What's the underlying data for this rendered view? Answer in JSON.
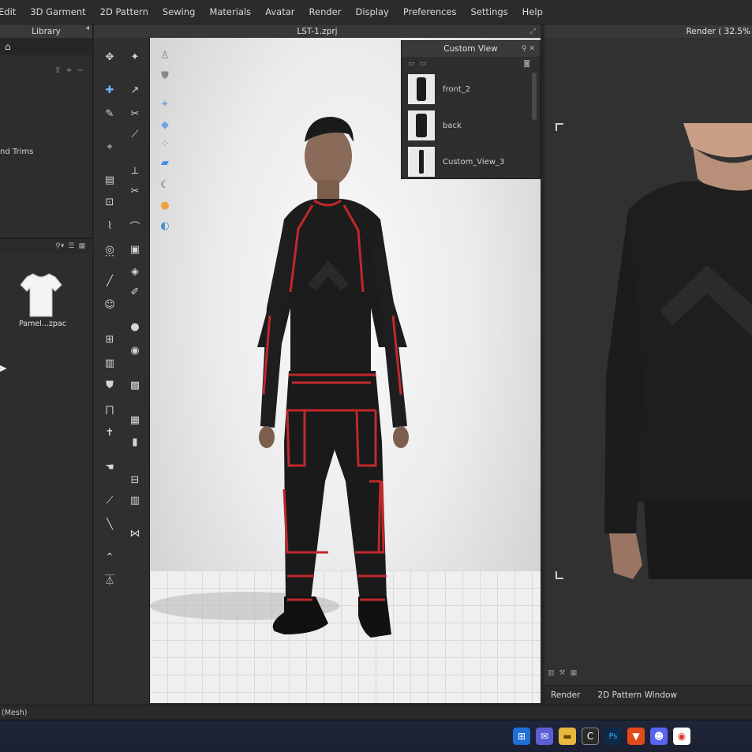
{
  "menu": {
    "items": [
      "Edit",
      "3D Garment",
      "2D Pattern",
      "Sewing",
      "Materials",
      "Avatar",
      "Render",
      "Display",
      "Preferences",
      "Settings",
      "Help"
    ]
  },
  "library": {
    "title": "Library",
    "item_label": "nd Trims",
    "thumbnail_label": "Pamel...zpac"
  },
  "viewport": {
    "title": "LST-1.zprj"
  },
  "custom_view": {
    "title": "Custom View",
    "items": [
      {
        "label": "front_2"
      },
      {
        "label": "back"
      },
      {
        "label": "Custom_View_3"
      }
    ]
  },
  "render": {
    "title": "Render ( 32.5%",
    "tabs": [
      "Render",
      "2D Pattern Window"
    ]
  },
  "status": {
    "text": "(Mesh)"
  },
  "taskbar": {
    "icons": [
      "windows-start-icon",
      "chat-icon",
      "file-explorer-icon",
      "clo-app-icon",
      "photoshop-icon",
      "brave-browser-icon",
      "discord-icon",
      "chrome-icon"
    ]
  },
  "colors": {
    "menubar_bg": "#2b2b2b",
    "panel_bg": "#2d2d2d",
    "garment_black": "#1c1c1c",
    "seam_red": "#c0282c",
    "taskbar_bg": "#1d2234"
  }
}
